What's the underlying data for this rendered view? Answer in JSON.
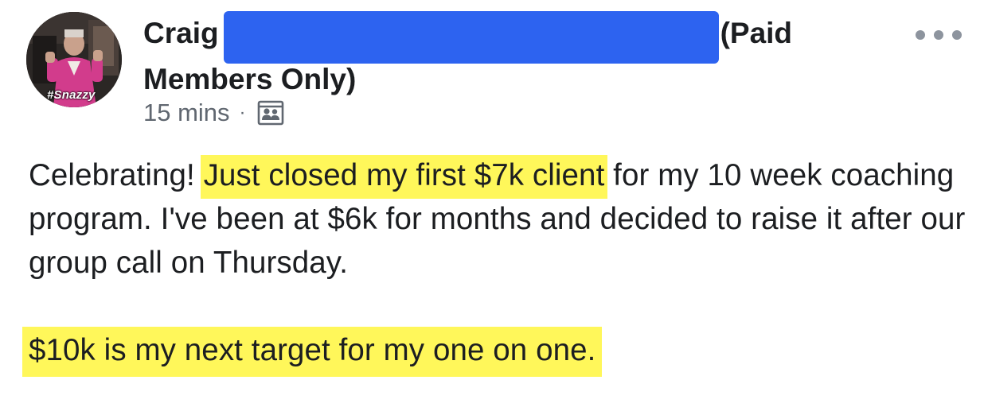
{
  "post": {
    "author": {
      "first_name": "Craig",
      "avatar_badge": "#Snazzy"
    },
    "group": {
      "suffix": "(Paid",
      "line2": "Members Only)"
    },
    "meta": {
      "timestamp": "15 mins",
      "separator": "·",
      "audience_icon": "group-members-icon"
    },
    "body": {
      "p1_before": "Celebrating! ",
      "p1_highlight": "Just closed my first $7k client",
      "p1_after": " for my 10 week coaching program. I've been at $6k for months and decided to raise it after our group call on Thursday.",
      "p2_highlight": "$10k is my next target for my one on one."
    },
    "colors": {
      "highlight": "#fff75a",
      "redaction": "#2d63f0",
      "text": "#1c1e21",
      "meta_text": "#606770",
      "more_dots": "#8d949e"
    },
    "more_icon": "more-options-icon"
  }
}
